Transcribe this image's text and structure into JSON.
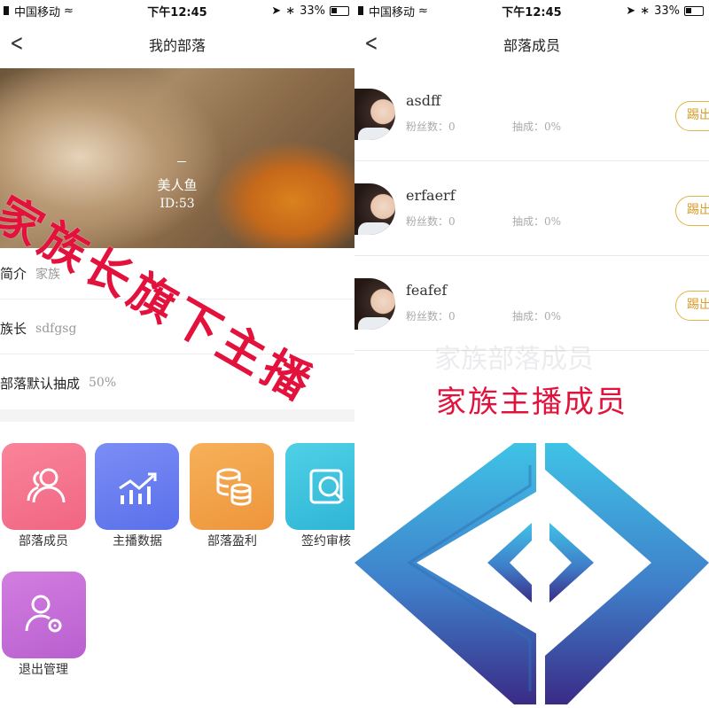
{
  "status_left": {
    "carrier": "中国移动",
    "time": "下午12:45",
    "battery": "33%"
  },
  "status_right": {
    "carrier": "中国移动",
    "time": "下午12:45",
    "battery": "33%"
  },
  "left_screen": {
    "title": "我的部落",
    "profile": {
      "name": "美人鱼",
      "id": "ID:53"
    },
    "info": [
      {
        "label": "简介",
        "value": "家族"
      },
      {
        "label": "族长",
        "value": "sdfgsg"
      },
      {
        "label": "部落默认抽成",
        "value": "50%"
      }
    ],
    "tiles": [
      {
        "label": "部落成员",
        "icon": "members-icon",
        "color": "#f4768f"
      },
      {
        "label": "主播数据",
        "icon": "chart-icon",
        "color": "#6a7ff0"
      },
      {
        "label": "部落盈利",
        "icon": "coins-icon",
        "color": "#f0a34a"
      },
      {
        "label": "签约审核",
        "icon": "review-icon",
        "color": "#3ec6de"
      },
      {
        "label": "退出管理",
        "icon": "user-settings-icon",
        "color": "#c56fd6"
      }
    ],
    "overlay_text": "家族长旗下主播"
  },
  "right_screen": {
    "title": "部落成员",
    "members": [
      {
        "name": "asdff",
        "fans": "粉丝数：0",
        "cut": "抽成：0%",
        "action": "踢出"
      },
      {
        "name": "erfaerf",
        "fans": "粉丝数：0",
        "cut": "抽成：0%",
        "action": "踢出"
      },
      {
        "name": "feafef",
        "fans": "粉丝数：0",
        "cut": "抽成：0%",
        "action": "踢出"
      }
    ],
    "faded_text": "家族部落成员",
    "caption": "家族主播成员"
  },
  "colors": {
    "accent_red": "#e3123c",
    "kick_border": "#e0b347",
    "logo_top": "#3fb9e0",
    "logo_bottom": "#3a2f8a"
  }
}
